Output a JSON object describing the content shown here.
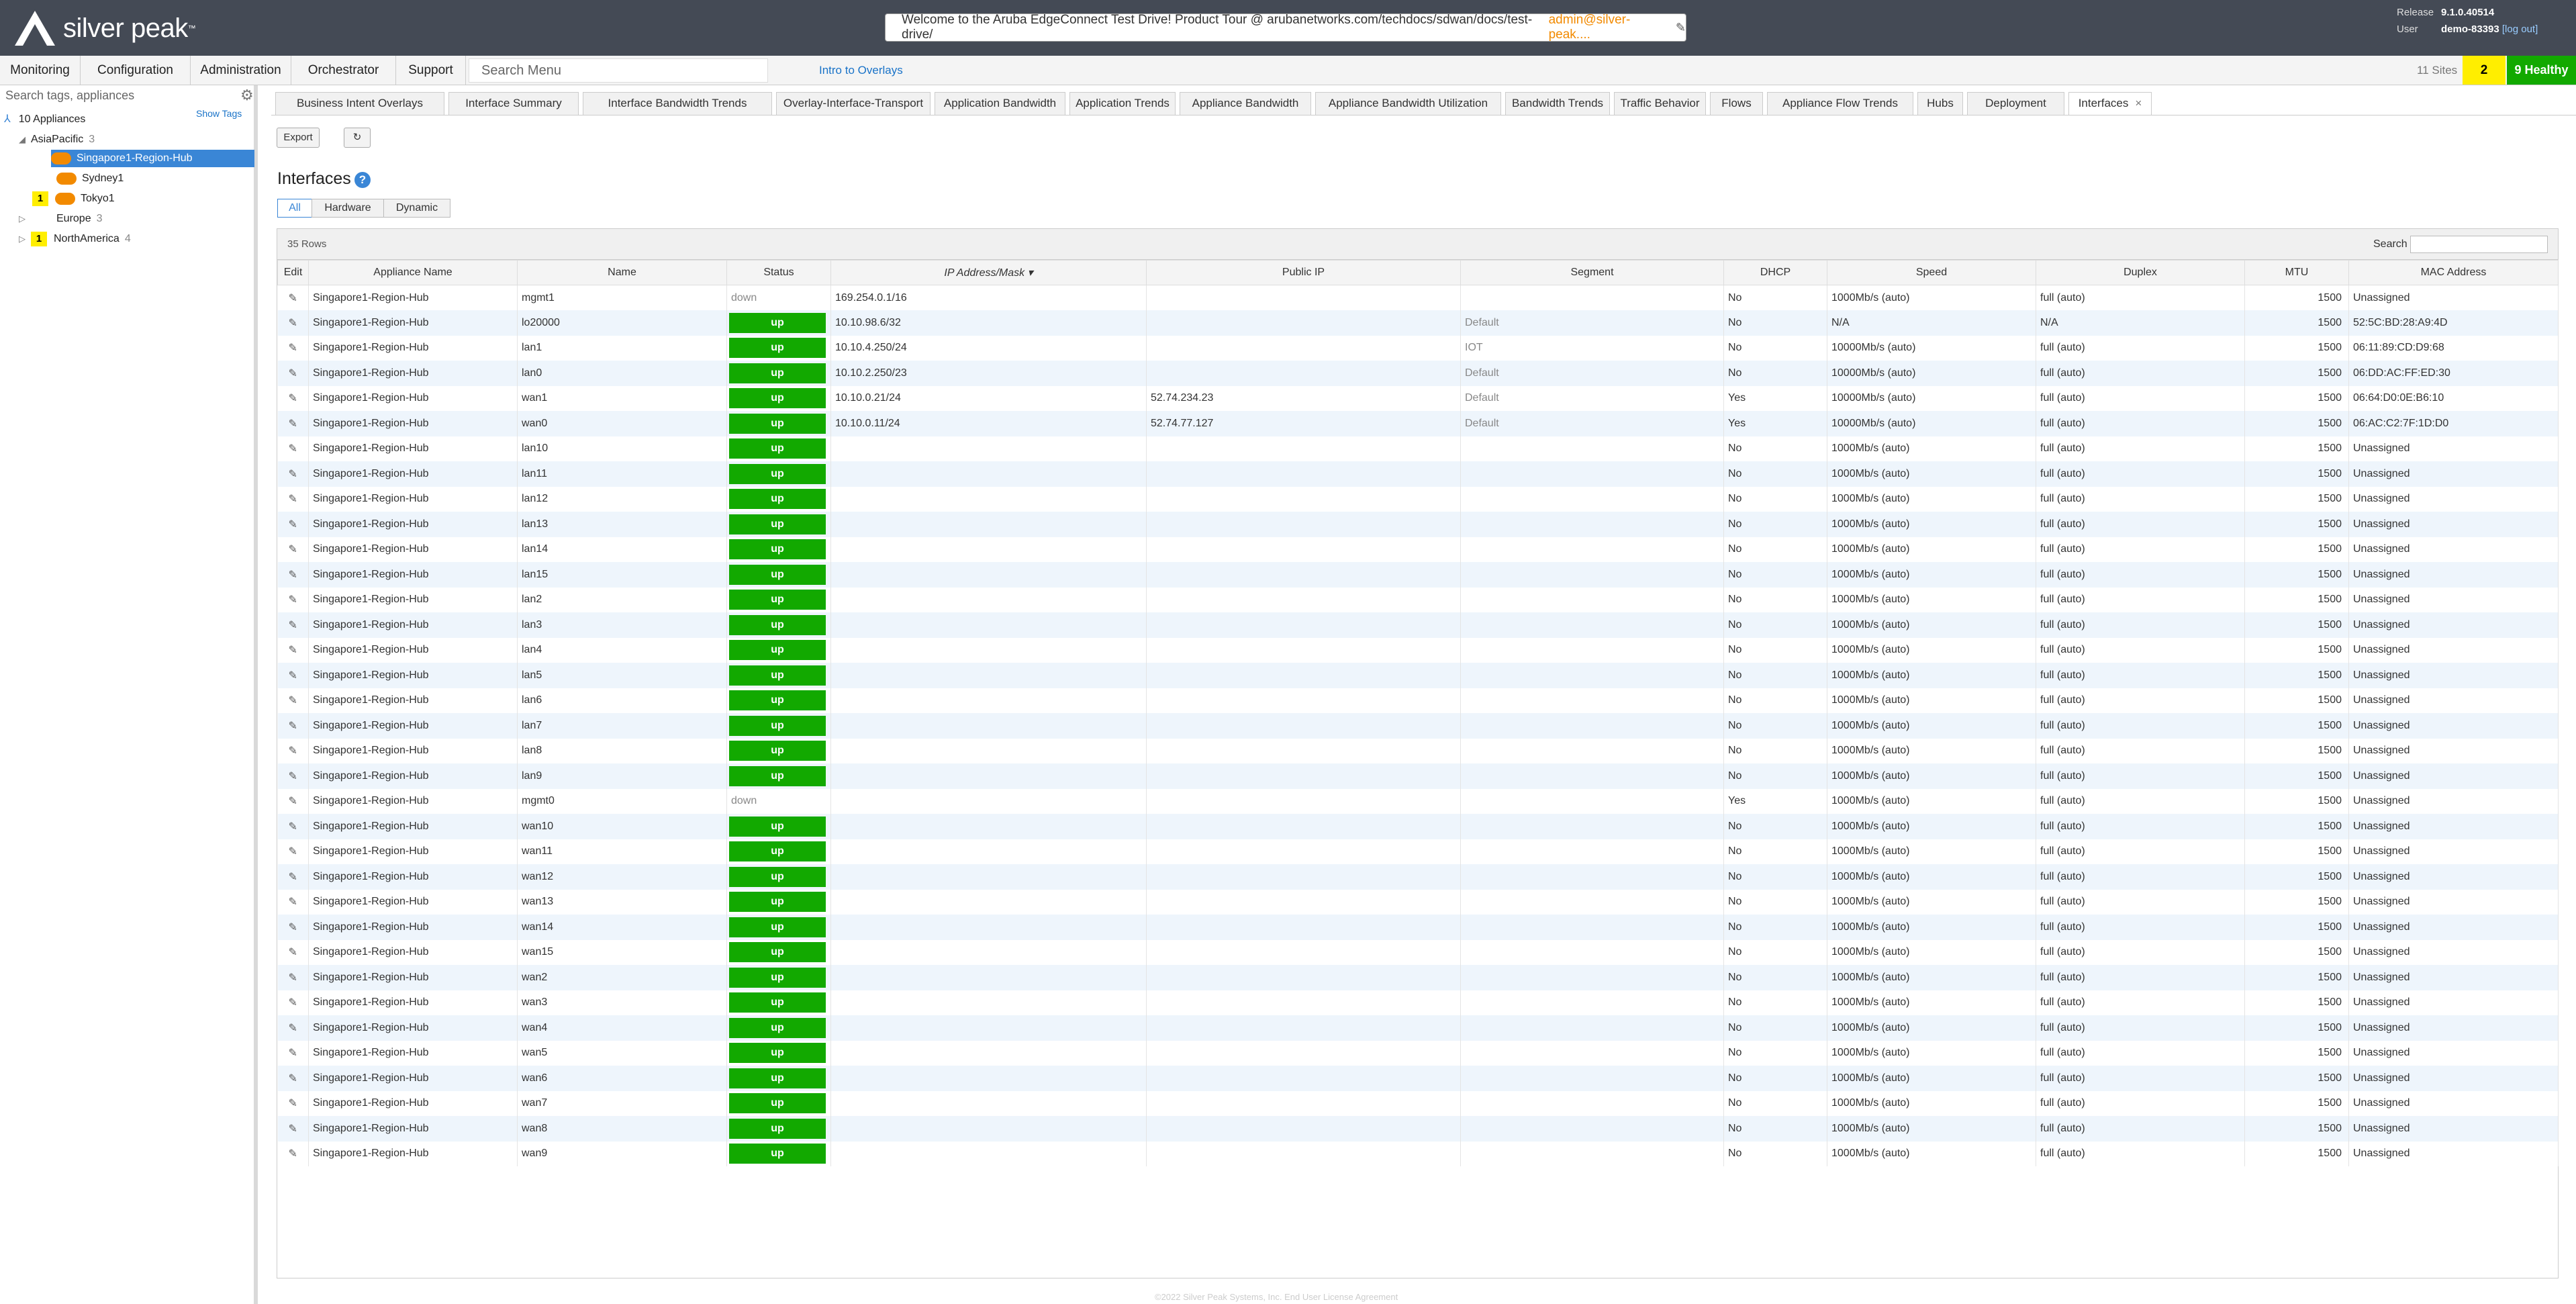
{
  "header": {
    "brand": "silver peak",
    "tm": "™",
    "welcome": "Welcome to the Aruba EdgeConnect Test Drive! Product Tour @ arubanetworks.com/techdocs/sdwan/docs/test-drive/",
    "user_email": "admin@silver-peak....",
    "release_label": "Release",
    "release_value": "9.1.0.40514",
    "user_label": "User",
    "user_value": "demo-83393",
    "logout": "[log out]"
  },
  "nav": {
    "items": [
      "Monitoring",
      "Configuration",
      "Administration",
      "Orchestrator",
      "Support"
    ],
    "search_placeholder": "Search Menu",
    "intro": "Intro to Overlays",
    "sites": "11 Sites",
    "alarm_count": "2",
    "healthy": "9 Healthy"
  },
  "sidebar": {
    "search_placeholder": "Search tags, appliances",
    "show_tags": "Show Tags",
    "root": "10 Appliances",
    "asia": "AsiaPacific",
    "asia_count": "3",
    "singapore": "Singapore1-Region-Hub",
    "sydney": "Sydney1",
    "tokyo": "Tokyo1",
    "tokyo_badge": "1",
    "europe": "Europe",
    "europe_count": "3",
    "na": "NorthAmerica",
    "na_count": "4",
    "na_badge": "1"
  },
  "tabs": [
    "Business Intent Overlays",
    "Interface Summary",
    "Interface Bandwidth Trends",
    "Overlay-Interface-Transport",
    "Application Bandwidth",
    "Application Trends",
    "Appliance Bandwidth",
    "Appliance Bandwidth Utilization",
    "Bandwidth Trends",
    "Traffic Behavior",
    "Flows",
    "Appliance Flow Trends",
    "Hubs",
    "Deployment",
    "Interfaces"
  ],
  "toolbar": {
    "export": "Export",
    "refresh": "↻"
  },
  "page": {
    "title": "Interfaces",
    "help": "?",
    "filters": [
      "All",
      "Hardware",
      "Dynamic"
    ]
  },
  "grid": {
    "row_count": "35 Rows",
    "search_label": "Search",
    "columns": [
      "Edit",
      "Appliance Name",
      "Name",
      "Status",
      "IP Address/Mask ▾",
      "Public IP",
      "Segment",
      "DHCP",
      "Speed",
      "Duplex",
      "MTU",
      "MAC Address"
    ],
    "rows": [
      [
        "Singapore1-Region-Hub",
        "mgmt1",
        "down",
        "169.254.0.1/16",
        "",
        "",
        "No",
        "1000Mb/s (auto)",
        "full (auto)",
        "1500",
        "Unassigned"
      ],
      [
        "Singapore1-Region-Hub",
        "lo20000",
        "up",
        "10.10.98.6/32",
        "",
        "Default",
        "No",
        "N/A",
        "N/A",
        "1500",
        "52:5C:BD:28:A9:4D"
      ],
      [
        "Singapore1-Region-Hub",
        "lan1",
        "up",
        "10.10.4.250/24",
        "",
        "IOT",
        "No",
        "10000Mb/s (auto)",
        "full (auto)",
        "1500",
        "06:11:89:CD:D9:68"
      ],
      [
        "Singapore1-Region-Hub",
        "lan0",
        "up",
        "10.10.2.250/23",
        "",
        "Default",
        "No",
        "10000Mb/s (auto)",
        "full (auto)",
        "1500",
        "06:DD:AC:FF:ED:30"
      ],
      [
        "Singapore1-Region-Hub",
        "wan1",
        "up",
        "10.10.0.21/24",
        "52.74.234.23",
        "Default",
        "Yes",
        "10000Mb/s (auto)",
        "full (auto)",
        "1500",
        "06:64:D0:0E:B6:10"
      ],
      [
        "Singapore1-Region-Hub",
        "wan0",
        "up",
        "10.10.0.11/24",
        "52.74.77.127",
        "Default",
        "Yes",
        "10000Mb/s (auto)",
        "full (auto)",
        "1500",
        "06:AC:C2:7F:1D:D0"
      ],
      [
        "Singapore1-Region-Hub",
        "lan10",
        "up",
        "",
        "",
        "",
        "No",
        "1000Mb/s (auto)",
        "full (auto)",
        "1500",
        "Unassigned"
      ],
      [
        "Singapore1-Region-Hub",
        "lan11",
        "up",
        "",
        "",
        "",
        "No",
        "1000Mb/s (auto)",
        "full (auto)",
        "1500",
        "Unassigned"
      ],
      [
        "Singapore1-Region-Hub",
        "lan12",
        "up",
        "",
        "",
        "",
        "No",
        "1000Mb/s (auto)",
        "full (auto)",
        "1500",
        "Unassigned"
      ],
      [
        "Singapore1-Region-Hub",
        "lan13",
        "up",
        "",
        "",
        "",
        "No",
        "1000Mb/s (auto)",
        "full (auto)",
        "1500",
        "Unassigned"
      ],
      [
        "Singapore1-Region-Hub",
        "lan14",
        "up",
        "",
        "",
        "",
        "No",
        "1000Mb/s (auto)",
        "full (auto)",
        "1500",
        "Unassigned"
      ],
      [
        "Singapore1-Region-Hub",
        "lan15",
        "up",
        "",
        "",
        "",
        "No",
        "1000Mb/s (auto)",
        "full (auto)",
        "1500",
        "Unassigned"
      ],
      [
        "Singapore1-Region-Hub",
        "lan2",
        "up",
        "",
        "",
        "",
        "No",
        "1000Mb/s (auto)",
        "full (auto)",
        "1500",
        "Unassigned"
      ],
      [
        "Singapore1-Region-Hub",
        "lan3",
        "up",
        "",
        "",
        "",
        "No",
        "1000Mb/s (auto)",
        "full (auto)",
        "1500",
        "Unassigned"
      ],
      [
        "Singapore1-Region-Hub",
        "lan4",
        "up",
        "",
        "",
        "",
        "No",
        "1000Mb/s (auto)",
        "full (auto)",
        "1500",
        "Unassigned"
      ],
      [
        "Singapore1-Region-Hub",
        "lan5",
        "up",
        "",
        "",
        "",
        "No",
        "1000Mb/s (auto)",
        "full (auto)",
        "1500",
        "Unassigned"
      ],
      [
        "Singapore1-Region-Hub",
        "lan6",
        "up",
        "",
        "",
        "",
        "No",
        "1000Mb/s (auto)",
        "full (auto)",
        "1500",
        "Unassigned"
      ],
      [
        "Singapore1-Region-Hub",
        "lan7",
        "up",
        "",
        "",
        "",
        "No",
        "1000Mb/s (auto)",
        "full (auto)",
        "1500",
        "Unassigned"
      ],
      [
        "Singapore1-Region-Hub",
        "lan8",
        "up",
        "",
        "",
        "",
        "No",
        "1000Mb/s (auto)",
        "full (auto)",
        "1500",
        "Unassigned"
      ],
      [
        "Singapore1-Region-Hub",
        "lan9",
        "up",
        "",
        "",
        "",
        "No",
        "1000Mb/s (auto)",
        "full (auto)",
        "1500",
        "Unassigned"
      ],
      [
        "Singapore1-Region-Hub",
        "mgmt0",
        "down",
        "",
        "",
        "",
        "Yes",
        "1000Mb/s (auto)",
        "full (auto)",
        "1500",
        "Unassigned"
      ],
      [
        "Singapore1-Region-Hub",
        "wan10",
        "up",
        "",
        "",
        "",
        "No",
        "1000Mb/s (auto)",
        "full (auto)",
        "1500",
        "Unassigned"
      ],
      [
        "Singapore1-Region-Hub",
        "wan11",
        "up",
        "",
        "",
        "",
        "No",
        "1000Mb/s (auto)",
        "full (auto)",
        "1500",
        "Unassigned"
      ],
      [
        "Singapore1-Region-Hub",
        "wan12",
        "up",
        "",
        "",
        "",
        "No",
        "1000Mb/s (auto)",
        "full (auto)",
        "1500",
        "Unassigned"
      ],
      [
        "Singapore1-Region-Hub",
        "wan13",
        "up",
        "",
        "",
        "",
        "No",
        "1000Mb/s (auto)",
        "full (auto)",
        "1500",
        "Unassigned"
      ],
      [
        "Singapore1-Region-Hub",
        "wan14",
        "up",
        "",
        "",
        "",
        "No",
        "1000Mb/s (auto)",
        "full (auto)",
        "1500",
        "Unassigned"
      ],
      [
        "Singapore1-Region-Hub",
        "wan15",
        "up",
        "",
        "",
        "",
        "No",
        "1000Mb/s (auto)",
        "full (auto)",
        "1500",
        "Unassigned"
      ],
      [
        "Singapore1-Region-Hub",
        "wan2",
        "up",
        "",
        "",
        "",
        "No",
        "1000Mb/s (auto)",
        "full (auto)",
        "1500",
        "Unassigned"
      ],
      [
        "Singapore1-Region-Hub",
        "wan3",
        "up",
        "",
        "",
        "",
        "No",
        "1000Mb/s (auto)",
        "full (auto)",
        "1500",
        "Unassigned"
      ],
      [
        "Singapore1-Region-Hub",
        "wan4",
        "up",
        "",
        "",
        "",
        "No",
        "1000Mb/s (auto)",
        "full (auto)",
        "1500",
        "Unassigned"
      ],
      [
        "Singapore1-Region-Hub",
        "wan5",
        "up",
        "",
        "",
        "",
        "No",
        "1000Mb/s (auto)",
        "full (auto)",
        "1500",
        "Unassigned"
      ],
      [
        "Singapore1-Region-Hub",
        "wan6",
        "up",
        "",
        "",
        "",
        "No",
        "1000Mb/s (auto)",
        "full (auto)",
        "1500",
        "Unassigned"
      ],
      [
        "Singapore1-Region-Hub",
        "wan7",
        "up",
        "",
        "",
        "",
        "No",
        "1000Mb/s (auto)",
        "full (auto)",
        "1500",
        "Unassigned"
      ],
      [
        "Singapore1-Region-Hub",
        "wan8",
        "up",
        "",
        "",
        "",
        "No",
        "1000Mb/s (auto)",
        "full (auto)",
        "1500",
        "Unassigned"
      ],
      [
        "Singapore1-Region-Hub",
        "wan9",
        "up",
        "",
        "",
        "",
        "No",
        "1000Mb/s (auto)",
        "full (auto)",
        "1500",
        "Unassigned"
      ]
    ]
  },
  "footer": "©2022 Silver Peak Systems, Inc. End User License Agreement",
  "colors": {
    "header_bg": "#444a55",
    "status_up": "#12a900",
    "alarm": "#ffee00",
    "healthy": "#12a900",
    "accent": "#3a86d6",
    "row_alt": "#eef5fc"
  }
}
